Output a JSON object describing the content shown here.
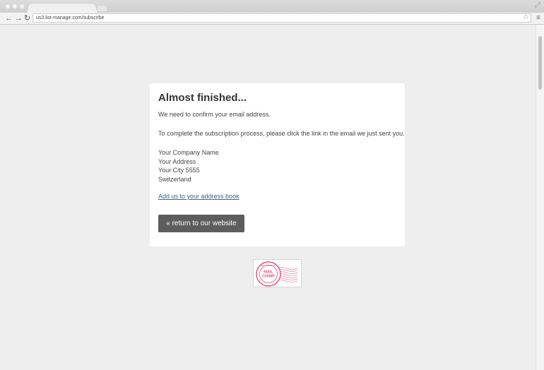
{
  "browser": {
    "url": "us3.list-manage.com/subscribe",
    "back_icon": "←",
    "forward_icon": "→",
    "reload_icon": "↻",
    "star_icon": "☆",
    "menu_icon": "≡",
    "fullscreen_icon": "⤢"
  },
  "card": {
    "title": "Almost finished...",
    "line1": "We need to confirm your email address.",
    "line2": "To complete the subscription process, please click the link in the email we just sent you.",
    "address": [
      "Your Company Name",
      "Your Address",
      "Your City 5555",
      "Switzerland"
    ],
    "address_book_link": "Add us to your address book",
    "return_button": "« return to our website"
  },
  "badge": {
    "text": "MAIL CHIMP",
    "ring_text": "DELIVERED BY",
    "color": "#e0507a"
  },
  "colors": {
    "button_bg": "#5d5d5d",
    "link": "#336699"
  }
}
